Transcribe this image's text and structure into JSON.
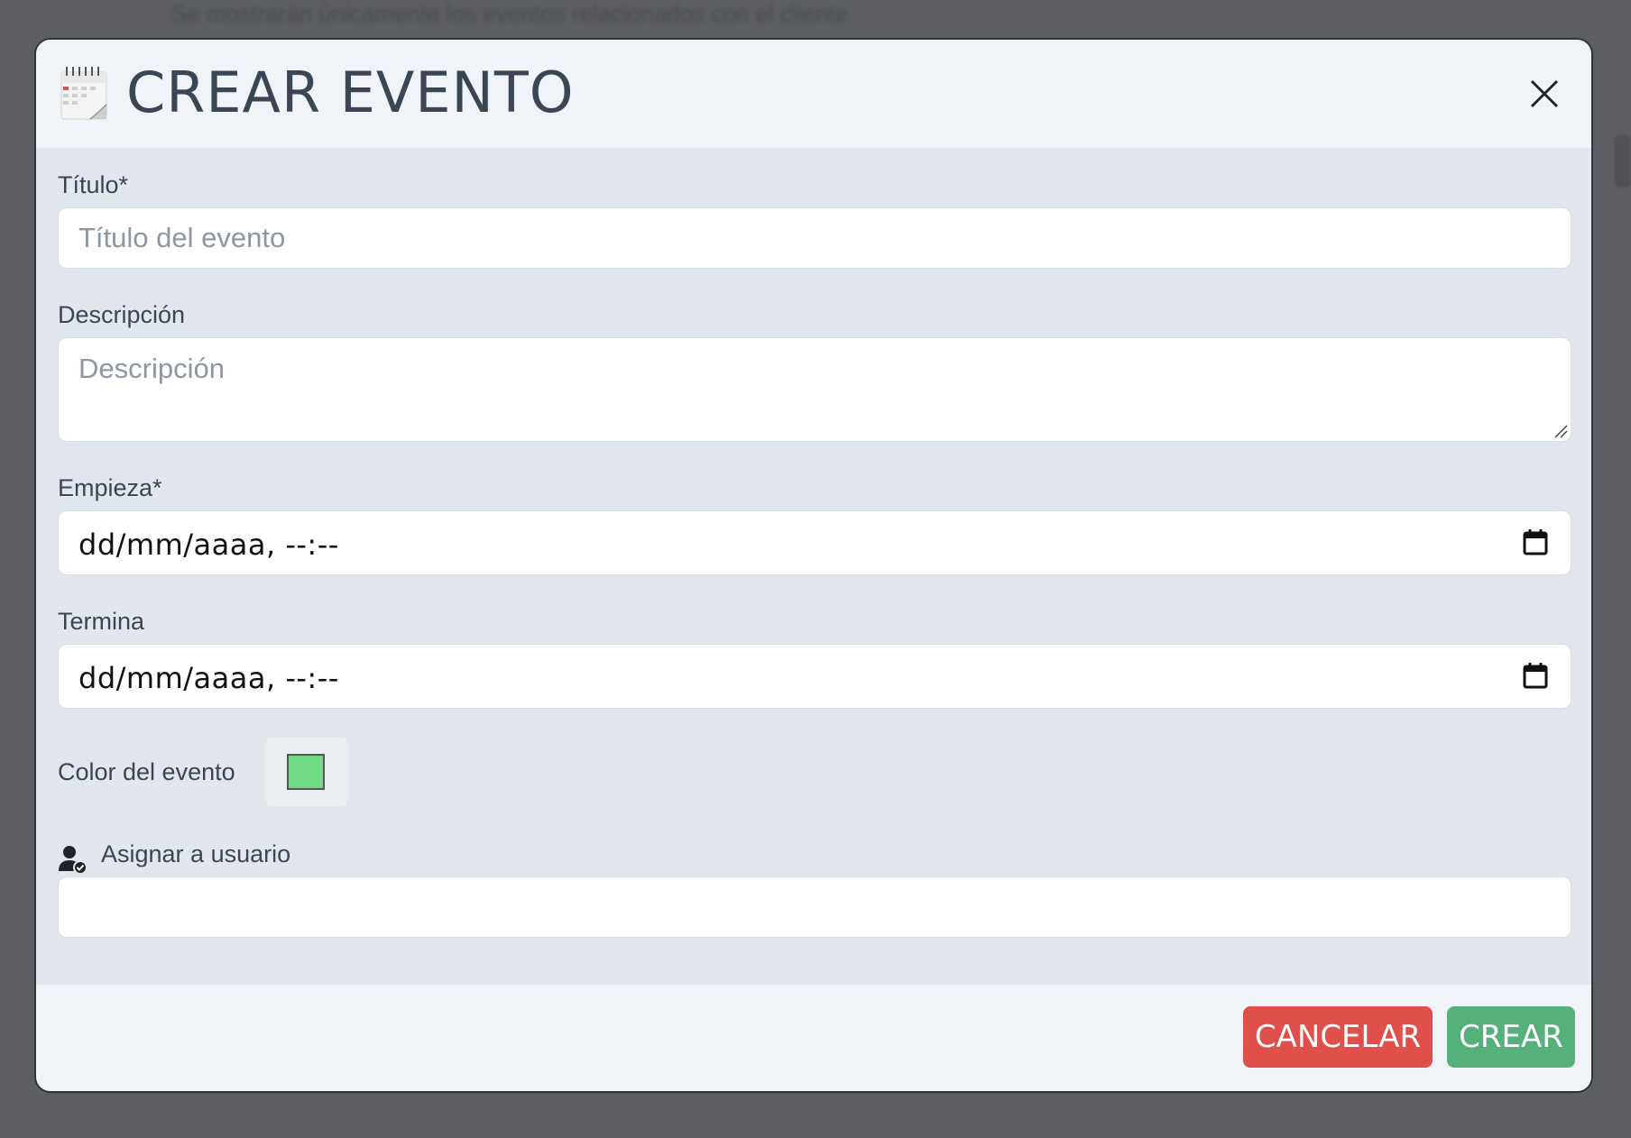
{
  "background": {
    "text": "Se mostrarán únicamente los eventos relacionados con el cliente"
  },
  "modal": {
    "title": "CREAR EVENTO",
    "icons": {
      "header": "calendar-icon",
      "close": "close-icon"
    },
    "fields": {
      "titulo": {
        "label": "Título*",
        "placeholder": "Título del evento",
        "value": ""
      },
      "descripcion": {
        "label": "Descripción",
        "placeholder": "Descripción",
        "value": ""
      },
      "empieza": {
        "label": "Empieza*",
        "value": "dd/mm/aaaa, --:--",
        "icon": "calendar-icon"
      },
      "termina": {
        "label": "Termina",
        "value": "dd/mm/aaaa, --:--",
        "icon": "calendar-icon"
      },
      "color": {
        "label": "Color del evento",
        "value": "#6fdc84"
      },
      "usuario": {
        "label": "Asignar a usuario",
        "icon": "user-check-icon",
        "value": ""
      }
    },
    "buttons": {
      "cancel": {
        "label": "CANCELAR",
        "color": "#e04f4a"
      },
      "create": {
        "label": "CREAR",
        "color": "#55b07a"
      }
    }
  },
  "colors": {
    "header_bg": "#f0f4f8",
    "body_bg": "#e2e7ee",
    "text": "#3a4556"
  }
}
